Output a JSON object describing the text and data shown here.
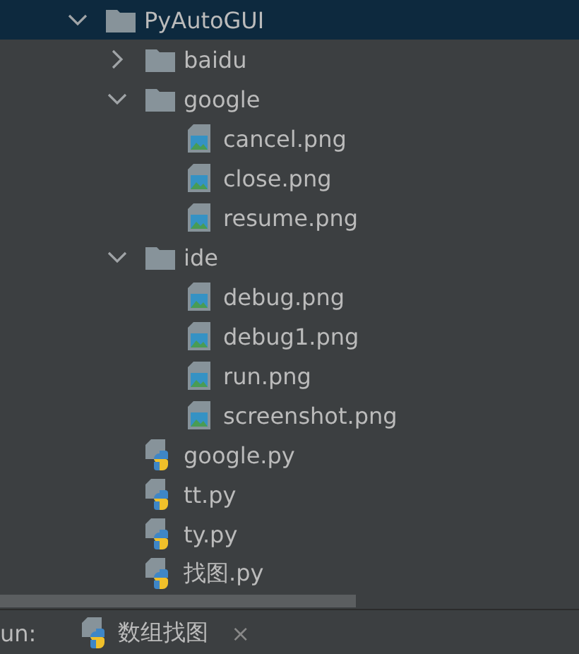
{
  "tree": [
    {
      "label": "PyAutoGUI",
      "kind": "folder",
      "expanded": true,
      "selected": true,
      "children": [
        {
          "label": "baidu",
          "kind": "folder",
          "expanded": false,
          "selected": false
        },
        {
          "label": "google",
          "kind": "folder",
          "expanded": true,
          "selected": false,
          "children": [
            {
              "label": "cancel.png",
              "kind": "image",
              "selected": false
            },
            {
              "label": "close.png",
              "kind": "image",
              "selected": false
            },
            {
              "label": "resume.png",
              "kind": "image",
              "selected": false
            }
          ]
        },
        {
          "label": "ide",
          "kind": "folder",
          "expanded": true,
          "selected": false,
          "children": [
            {
              "label": "debug.png",
              "kind": "image",
              "selected": false
            },
            {
              "label": "debug1.png",
              "kind": "image",
              "selected": false
            },
            {
              "label": "run.png",
              "kind": "image",
              "selected": false
            },
            {
              "label": "screenshot.png",
              "kind": "image",
              "selected": false
            }
          ]
        },
        {
          "label": "google.py",
          "kind": "python",
          "selected": false
        },
        {
          "label": "tt.py",
          "kind": "python",
          "selected": false
        },
        {
          "label": "ty.py",
          "kind": "python",
          "selected": false
        },
        {
          "label": "找图.py",
          "kind": "python",
          "selected": false
        }
      ]
    }
  ],
  "run_panel": {
    "label": "un:",
    "tab": {
      "label": "数组找图",
      "close": "×"
    }
  }
}
